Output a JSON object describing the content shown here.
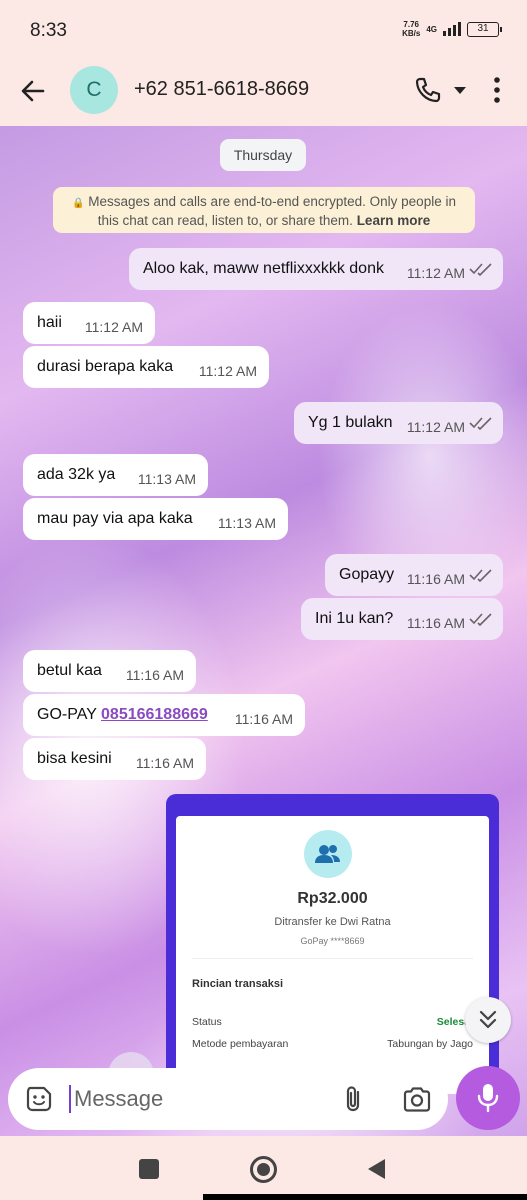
{
  "status_bar": {
    "time": "8:33",
    "net_speed_value": "7.76",
    "net_speed_unit": "KB/s",
    "network": "4G",
    "battery": "31"
  },
  "header": {
    "avatar_letter": "C",
    "contact_name": "+62 851-6618-8669"
  },
  "chat": {
    "day_label": "Thursday",
    "encryption_notice": "Messages and calls are end-to-end encrypted. Only people in this chat can read, listen to, or share them.",
    "encryption_learn_more": "Learn more",
    "messages": [
      {
        "direction": "out",
        "text": "Aloo kak, maww netflixxxkkk donk",
        "time": "11:12 AM"
      },
      {
        "direction": "in",
        "text": "haii",
        "time": "11:12 AM"
      },
      {
        "direction": "in",
        "text": "durasi berapa kaka",
        "time": "11:12 AM"
      },
      {
        "direction": "out",
        "text": "Yg 1 bulakn",
        "time": "11:12 AM"
      },
      {
        "direction": "in",
        "text": "ada 32k ya",
        "time": "11:13 AM"
      },
      {
        "direction": "in",
        "text": "mau pay via apa kaka",
        "time": "11:13 AM"
      },
      {
        "direction": "out",
        "text": "Gopayy",
        "time": "11:16 AM"
      },
      {
        "direction": "out",
        "text": "Ini 1u kan?",
        "time": "11:16 AM"
      },
      {
        "direction": "in",
        "text": "betul kaa",
        "time": "11:16 AM"
      },
      {
        "direction": "in",
        "text_prefix": "GO-PAY ",
        "link": "085166188669",
        "time": "11:16 AM"
      },
      {
        "direction": "in",
        "text": "bisa kesini",
        "time": "11:16 AM"
      }
    ],
    "receipt": {
      "amount": "Rp32.000",
      "recipient": "Ditransfer ke Dwi Ratna",
      "account": "GoPay ****8669",
      "section_title": "Rincian transaksi",
      "status_label": "Status",
      "status_value": "Selesai",
      "method_label": "Metode pembayaran",
      "method_value": "Tabungan by Jago"
    }
  },
  "input": {
    "placeholder": "Message"
  },
  "colors": {
    "outgoing_bubble": "#f1e6f8",
    "incoming_bubble": "#ffffff",
    "mic_button": "#b55be0",
    "link": "#8a4bc2",
    "header_bg": "#fce8e4"
  }
}
